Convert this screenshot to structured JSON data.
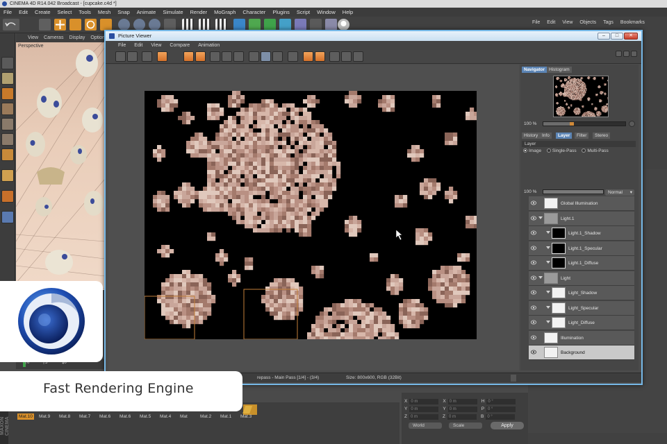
{
  "app": {
    "title": "CINEMA 4D R14.042 Broadcast - [cupcake.c4d *]",
    "menu": [
      "File",
      "Edit",
      "Create",
      "Select",
      "Tools",
      "Mesh",
      "Snap",
      "Animate",
      "Simulate",
      "Render",
      "MoGraph",
      "Character",
      "Plugins",
      "Script",
      "Window",
      "Help"
    ]
  },
  "right_manager": {
    "menu": [
      "File",
      "Edit",
      "View",
      "Objects",
      "Tags",
      "Bookmarks"
    ]
  },
  "viewport": {
    "menu": [
      "View",
      "Cameras",
      "Display",
      "Option"
    ],
    "label": "Perspective"
  },
  "picture_viewer": {
    "title": "Picture Viewer",
    "window_buttons": {
      "minimize": "–",
      "maximize": "□",
      "close": "✕"
    },
    "menu": [
      "File",
      "Edit",
      "View",
      "Compare",
      "Animation"
    ],
    "status_left": "repass - Main Pass [1/4] - (3/4)",
    "status_right": "Size: 800x600, RGB (32Bit)",
    "sidebar": {
      "top_tabs": [
        "Navigator",
        "Histogram"
      ],
      "zoom_value": "100 %",
      "tabs": [
        "History",
        "Info",
        "Layer",
        "Filter",
        "Stereo"
      ],
      "active_tab": "Layer",
      "section_label": "Layer",
      "modes": [
        "Image",
        "Single-Pass",
        "Multi-Pass"
      ],
      "selected_mode": "Image",
      "opacity_value": "100 %",
      "blend_mode": "Normal",
      "layers": [
        {
          "name": "Global Illumination",
          "level": 0,
          "expandable": false,
          "thumb": "white"
        },
        {
          "name": "Light.1",
          "level": 0,
          "expandable": true,
          "thumb": "folder"
        },
        {
          "name": "Light.1_Shadow",
          "level": 1,
          "expandable": false,
          "thumb": "black"
        },
        {
          "name": "Light.1_Specular",
          "level": 1,
          "expandable": false,
          "thumb": "black"
        },
        {
          "name": "Light.1_Diffuse",
          "level": 1,
          "expandable": false,
          "thumb": "black"
        },
        {
          "name": "Light",
          "level": 0,
          "expandable": true,
          "thumb": "folder"
        },
        {
          "name": "Light_Shadow",
          "level": 1,
          "expandable": false,
          "thumb": "white"
        },
        {
          "name": "Light_Specular",
          "level": 1,
          "expandable": false,
          "thumb": "white"
        },
        {
          "name": "Light_Diffuse",
          "level": 1,
          "expandable": false,
          "thumb": "white"
        },
        {
          "name": "Illumination",
          "level": 0,
          "expandable": false,
          "thumb": "white"
        },
        {
          "name": "Background",
          "level": 0,
          "expandable": false,
          "thumb": "white",
          "selected": true
        }
      ]
    }
  },
  "timeline": {
    "ticks": [
      "0",
      "5",
      "10"
    ]
  },
  "materials": [
    "Mat.10",
    "Mat.9",
    "Mat.8",
    "Mat.7",
    "Mat.6",
    "Mat.6",
    "Mat.5",
    "Mat.4",
    "Mat",
    "Mat.2",
    "Mat.1",
    "Mat.3"
  ],
  "active_material": "Mat.10",
  "maxon_label": "MAXON CINEMA",
  "coordinates": {
    "rows": [
      {
        "axis": "X",
        "pos": "0 m",
        "size_axis": "X",
        "size": "0 m",
        "rot_axis": "H",
        "rot": "0 °"
      },
      {
        "axis": "Y",
        "pos": "0 m",
        "size_axis": "Y",
        "size": "0 m",
        "rot_axis": "P",
        "rot": "0 °"
      },
      {
        "axis": "Z",
        "pos": "0 m",
        "size_axis": "Z",
        "size": "0 m",
        "rot_axis": "B",
        "rot": "0 °"
      }
    ],
    "space_select": "World",
    "scale_select": "Scale",
    "apply_label": "Apply"
  },
  "overlay": {
    "caption": "Fast Rendering Engine"
  },
  "colors": {
    "accent_orange": "#d9902a",
    "window_border": "#77b9e8",
    "selected_tab": "#5b84b4"
  }
}
